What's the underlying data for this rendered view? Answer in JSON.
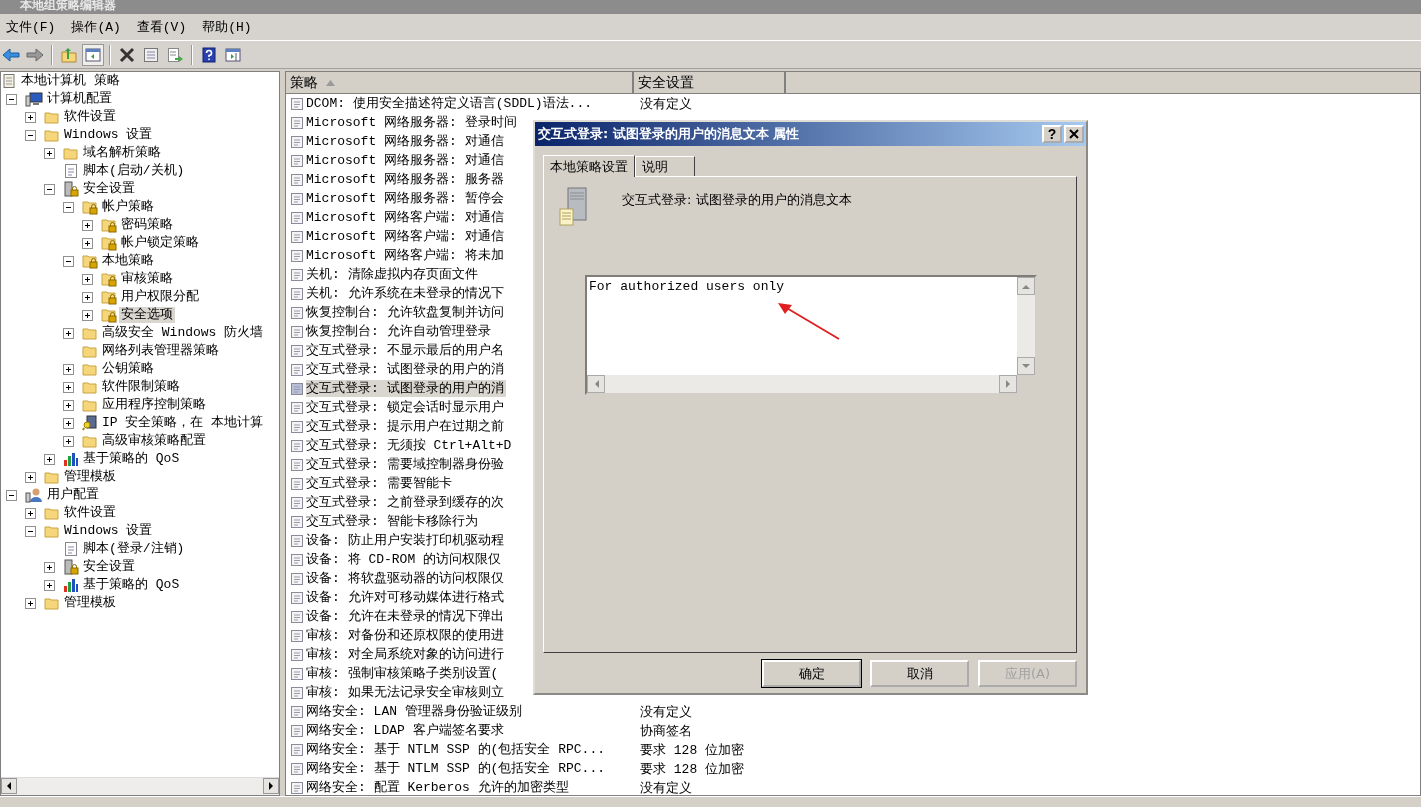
{
  "window": {
    "title": "本地组策略编辑器"
  },
  "menu": [
    "文件(F)",
    "操作(A)",
    "查看(V)",
    "帮助(H)"
  ],
  "toolbar": [
    [
      {
        "kind": "back",
        "pressed": false
      },
      {
        "kind": "forward",
        "pressed": false
      }
    ],
    [
      {
        "kind": "up",
        "pressed": false
      },
      {
        "kind": "tree",
        "pressed": true
      }
    ],
    [
      {
        "kind": "delete",
        "pressed": false
      },
      {
        "kind": "properties",
        "pressed": false
      },
      {
        "kind": "export",
        "pressed": false
      }
    ],
    [
      {
        "kind": "help",
        "pressed": false
      },
      {
        "kind": "actionpane",
        "pressed": false
      }
    ]
  ],
  "tree": {
    "items": [
      {
        "label": "本地计算机 策略",
        "kind": "policy",
        "selected": false,
        "children": [
          {
            "label": "计算机配置",
            "kind": "computer",
            "expanded": true,
            "selected": false,
            "children": [
              {
                "label": "软件设置",
                "kind": "folder",
                "expanded": false,
                "selected": false
              },
              {
                "label": "Windows 设置",
                "kind": "folder",
                "expanded": true,
                "selected": false,
                "children": [
                  {
                    "label": "域名解析策略",
                    "kind": "folder",
                    "expanded": false,
                    "selected": false
                  },
                  {
                    "label": "脚本(启动/关机)",
                    "kind": "script",
                    "selected": false
                  },
                  {
                    "label": "安全设置",
                    "kind": "security",
                    "expanded": true,
                    "selected": false,
                    "children": [
                      {
                        "label": "帐户策略",
                        "kind": "lockfolder",
                        "expanded": true,
                        "selected": false,
                        "children": [
                          {
                            "label": "密码策略",
                            "kind": "lockfolder",
                            "expanded": false,
                            "selected": false
                          },
                          {
                            "label": "帐户锁定策略",
                            "kind": "lockfolder",
                            "expanded": false,
                            "selected": false
                          }
                        ]
                      },
                      {
                        "label": "本地策略",
                        "kind": "lockfolder",
                        "expanded": true,
                        "selected": false,
                        "children": [
                          {
                            "label": "审核策略",
                            "kind": "lockfolder",
                            "expanded": false,
                            "selected": false
                          },
                          {
                            "label": "用户权限分配",
                            "kind": "lockfolder",
                            "expanded": false,
                            "selected": false
                          },
                          {
                            "label": "安全选项",
                            "kind": "lockfolder",
                            "expanded": false,
                            "selected": true
                          }
                        ]
                      },
                      {
                        "label": "高级安全 Windows 防火墙",
                        "kind": "folder",
                        "expanded": false,
                        "selected": false
                      },
                      {
                        "label": "网络列表管理器策略",
                        "kind": "folder",
                        "selected": false
                      },
                      {
                        "label": "公钥策略",
                        "kind": "folder",
                        "expanded": false,
                        "selected": false
                      },
                      {
                        "label": "软件限制策略",
                        "kind": "folder",
                        "expanded": false,
                        "selected": false
                      },
                      {
                        "label": "应用程序控制策略",
                        "kind": "folder",
                        "expanded": false,
                        "selected": false
                      },
                      {
                        "label": "IP 安全策略，在 本地计算",
                        "kind": "ipsec",
                        "expanded": false,
                        "selected": false
                      },
                      {
                        "label": "高级审核策略配置",
                        "kind": "folder",
                        "expanded": false,
                        "selected": false
                      }
                    ]
                  },
                  {
                    "label": "基于策略的 QoS",
                    "kind": "qos",
                    "expanded": false,
                    "selected": false
                  }
                ]
              },
              {
                "label": "管理模板",
                "kind": "folder",
                "expanded": false,
                "selected": false
              }
            ]
          },
          {
            "label": "用户配置",
            "kind": "user",
            "expanded": true,
            "selected": false,
            "children": [
              {
                "label": "软件设置",
                "kind": "folder",
                "expanded": false,
                "selected": false
              },
              {
                "label": "Windows 设置",
                "kind": "folder",
                "expanded": true,
                "selected": false,
                "children": [
                  {
                    "label": "脚本(登录/注销)",
                    "kind": "script",
                    "selected": false
                  },
                  {
                    "label": "安全设置",
                    "kind": "security",
                    "expanded": false,
                    "selected": false
                  },
                  {
                    "label": "基于策略的 QoS",
                    "kind": "qos",
                    "expanded": false,
                    "selected": false
                  }
                ]
              },
              {
                "label": "管理模板",
                "kind": "folder",
                "expanded": false,
                "selected": false
              }
            ]
          }
        ]
      }
    ]
  },
  "list": {
    "columns": [
      {
        "label": "策略",
        "sorted": true
      },
      {
        "label": "安全设置",
        "sorted": false
      }
    ],
    "rows": [
      {
        "name": "DCOM: 使用安全描述符定义语言(SDDL)语法...",
        "value": "没有定义",
        "selected": false
      },
      {
        "name": "Microsoft 网络服务器: 登录时间",
        "selected": false
      },
      {
        "name": "Microsoft 网络服务器: 对通信",
        "selected": false
      },
      {
        "name": "Microsoft 网络服务器: 对通信",
        "selected": false
      },
      {
        "name": "Microsoft 网络服务器: 服务器",
        "selected": false
      },
      {
        "name": "Microsoft 网络服务器: 暂停会",
        "selected": false
      },
      {
        "name": "Microsoft 网络客户端: 对通信",
        "selected": false
      },
      {
        "name": "Microsoft 网络客户端: 对通信",
        "selected": false
      },
      {
        "name": "Microsoft 网络客户端: 将未加",
        "selected": false
      },
      {
        "name": "关机: 清除虚拟内存页面文件",
        "selected": false
      },
      {
        "name": "关机: 允许系统在未登录的情况下",
        "selected": false
      },
      {
        "name": "恢复控制台: 允许软盘复制并访问",
        "selected": false
      },
      {
        "name": "恢复控制台: 允许自动管理登录",
        "selected": false
      },
      {
        "name": "交互式登录: 不显示最后的用户名",
        "selected": false
      },
      {
        "name": "交互式登录: 试图登录的用户的消",
        "selected": false
      },
      {
        "name": "交互式登录: 试图登录的用户的消",
        "selected": true
      },
      {
        "name": "交互式登录: 锁定会话时显示用户",
        "selected": false
      },
      {
        "name": "交互式登录: 提示用户在过期之前",
        "selected": false
      },
      {
        "name": "交互式登录: 无须按 Ctrl+Alt+D",
        "selected": false
      },
      {
        "name": "交互式登录: 需要域控制器身份验",
        "selected": false
      },
      {
        "name": "交互式登录: 需要智能卡",
        "selected": false
      },
      {
        "name": "交互式登录: 之前登录到缓存的次",
        "selected": false
      },
      {
        "name": "交互式登录: 智能卡移除行为",
        "selected": false
      },
      {
        "name": "设备: 防止用户安装打印机驱动程",
        "selected": false
      },
      {
        "name": "设备: 将 CD-ROM 的访问权限仅",
        "selected": false
      },
      {
        "name": "设备: 将软盘驱动器的访问权限仅",
        "selected": false
      },
      {
        "name": "设备: 允许对可移动媒体进行格式",
        "selected": false
      },
      {
        "name": "设备: 允许在未登录的情况下弹出",
        "selected": false
      },
      {
        "name": "审核: 对备份和还原权限的使用进",
        "selected": false
      },
      {
        "name": "审核: 对全局系统对象的访问进行",
        "selected": false
      },
      {
        "name": "审核: 强制审核策略子类别设置(",
        "selected": false
      },
      {
        "name": "审核: 如果无法记录安全审核则立",
        "selected": false
      },
      {
        "name": "网络安全: LAN 管理器身份验证级别",
        "value": "没有定义",
        "selected": false
      },
      {
        "name": "网络安全: LDAP 客户端签名要求",
        "value": "协商签名",
        "selected": false
      },
      {
        "name": "网络安全: 基于 NTLM SSP 的(包括安全 RPC...",
        "value": "要求 128 位加密",
        "selected": false
      },
      {
        "name": "网络安全: 基于 NTLM SSP 的(包括安全 RPC...",
        "value": "要求 128 位加密",
        "selected": false
      },
      {
        "name": "网络安全: 配置 Kerberos 允许的加密类型",
        "value": "没有定义",
        "selected": false
      }
    ]
  },
  "dialog": {
    "title": "交互式登录: 试图登录的用户的消息文本 属性",
    "help_button": "?",
    "tabs": [
      {
        "label": "本地策略设置",
        "selected": true
      },
      {
        "label": "说明",
        "selected": false
      }
    ],
    "setting_name": "交互式登录: 试图登录的用户的消息文本",
    "message": "For authorized users only",
    "buttons": [
      {
        "label": "确定",
        "default": true,
        "disabled": false
      },
      {
        "label": "取消",
        "default": false,
        "disabled": false
      },
      {
        "label": "应用(A)",
        "default": false,
        "disabled": true
      }
    ]
  }
}
